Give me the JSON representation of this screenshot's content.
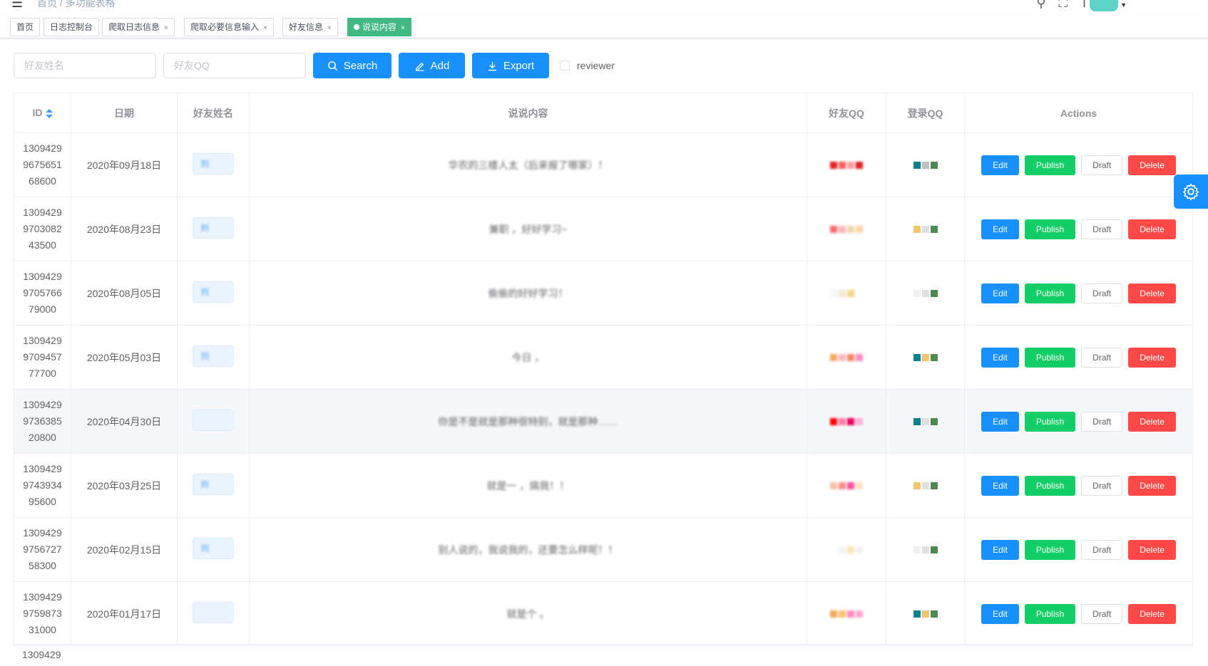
{
  "breadcrumb": {
    "home": "首页",
    "sep": "/",
    "current": "多功能表格"
  },
  "tags": [
    {
      "label": "首页",
      "closable": false,
      "active": false
    },
    {
      "label": "日志控制台",
      "closable": false,
      "active": false
    },
    {
      "label": "爬取日志信息",
      "closable": true,
      "active": false
    },
    {
      "label": "爬取必要信息输入",
      "closable": true,
      "active": false
    },
    {
      "label": "好友信息",
      "closable": true,
      "active": false
    },
    {
      "label": "说说内容",
      "closable": true,
      "active": true
    }
  ],
  "filter": {
    "name_placeholder": "好友姓名",
    "qq_placeholder": "好友QQ",
    "search_label": "Search",
    "add_label": "Add",
    "export_label": "Export",
    "reviewer_label": "reviewer"
  },
  "table": {
    "headers": {
      "id": "ID",
      "date": "日期",
      "name": "好友姓名",
      "content": "说说内容",
      "friend_qq": "好友QQ",
      "login_qq": "登录QQ",
      "actions": "Actions"
    },
    "actions": {
      "edit": "Edit",
      "publish": "Publish",
      "draft": "Draft",
      "delete": "Delete"
    },
    "rows": [
      {
        "id1": "1309429",
        "id2": "9675651",
        "id3": "68600",
        "date": "2020年09月18日",
        "name": "刘",
        "content": "华农的三楼人太（后来报了哪家）！"
      },
      {
        "id1": "1309429",
        "id2": "9703082",
        "id3": "43500",
        "date": "2020年08月23日",
        "name": "刘",
        "content": "兼职 ，好好学习~"
      },
      {
        "id1": "1309429",
        "id2": "9705766",
        "id3": "79000",
        "date": "2020年08月05日",
        "name": "刘",
        "content": "偷偷的好好学习！"
      },
      {
        "id1": "1309429",
        "id2": "9709457",
        "id3": "77700",
        "date": "2020年05月03日",
        "name": "刘",
        "content": "今日 ，"
      },
      {
        "id1": "1309429",
        "id2": "9736385",
        "id3": "20800",
        "date": "2020年04月30日",
        "name": "",
        "content": "你是不是就是那种很特别，就是那种……"
      },
      {
        "id1": "1309429",
        "id2": "9743934",
        "id3": "95600",
        "date": "2020年03月25日",
        "name": "刘",
        "content": "就是一 ，搞我！！"
      },
      {
        "id1": "1309429",
        "id2": "9756727",
        "id3": "58300",
        "date": "2020年02月15日",
        "name": "刘",
        "content": "别人说的，我说我的，还要怎么样呢！！"
      },
      {
        "id1": "1309429",
        "id2": "9759873",
        "id3": "31000",
        "date": "2020年01月17日",
        "name": "",
        "content": "就是个 。"
      }
    ],
    "partial_row_id": "1309429"
  },
  "colors": {
    "primary": "#1890ff",
    "success": "#13ce66",
    "danger": "#ff4949",
    "active_tag": "#42b983",
    "highlight_row": "#f5f7fa"
  }
}
